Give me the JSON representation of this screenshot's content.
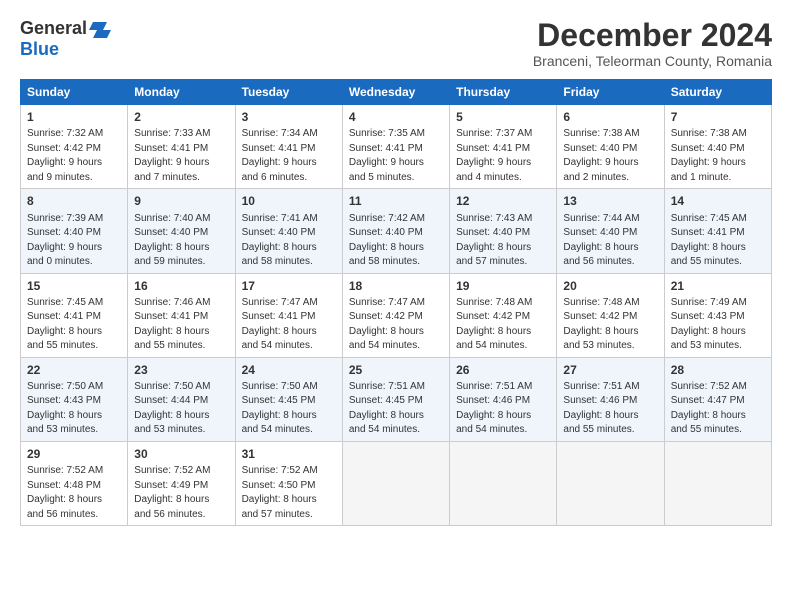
{
  "logo": {
    "general": "General",
    "blue": "Blue"
  },
  "title": {
    "month": "December 2024",
    "location": "Branceni, Teleorman County, Romania"
  },
  "weekdays": [
    "Sunday",
    "Monday",
    "Tuesday",
    "Wednesday",
    "Thursday",
    "Friday",
    "Saturday"
  ],
  "weeks": [
    [
      {
        "day": 1,
        "info": "Sunrise: 7:32 AM\nSunset: 4:42 PM\nDaylight: 9 hours\nand 9 minutes."
      },
      {
        "day": 2,
        "info": "Sunrise: 7:33 AM\nSunset: 4:41 PM\nDaylight: 9 hours\nand 7 minutes."
      },
      {
        "day": 3,
        "info": "Sunrise: 7:34 AM\nSunset: 4:41 PM\nDaylight: 9 hours\nand 6 minutes."
      },
      {
        "day": 4,
        "info": "Sunrise: 7:35 AM\nSunset: 4:41 PM\nDaylight: 9 hours\nand 5 minutes."
      },
      {
        "day": 5,
        "info": "Sunrise: 7:37 AM\nSunset: 4:41 PM\nDaylight: 9 hours\nand 4 minutes."
      },
      {
        "day": 6,
        "info": "Sunrise: 7:38 AM\nSunset: 4:40 PM\nDaylight: 9 hours\nand 2 minutes."
      },
      {
        "day": 7,
        "info": "Sunrise: 7:38 AM\nSunset: 4:40 PM\nDaylight: 9 hours\nand 1 minute."
      }
    ],
    [
      {
        "day": 8,
        "info": "Sunrise: 7:39 AM\nSunset: 4:40 PM\nDaylight: 9 hours\nand 0 minutes."
      },
      {
        "day": 9,
        "info": "Sunrise: 7:40 AM\nSunset: 4:40 PM\nDaylight: 8 hours\nand 59 minutes."
      },
      {
        "day": 10,
        "info": "Sunrise: 7:41 AM\nSunset: 4:40 PM\nDaylight: 8 hours\nand 58 minutes."
      },
      {
        "day": 11,
        "info": "Sunrise: 7:42 AM\nSunset: 4:40 PM\nDaylight: 8 hours\nand 58 minutes."
      },
      {
        "day": 12,
        "info": "Sunrise: 7:43 AM\nSunset: 4:40 PM\nDaylight: 8 hours\nand 57 minutes."
      },
      {
        "day": 13,
        "info": "Sunrise: 7:44 AM\nSunset: 4:40 PM\nDaylight: 8 hours\nand 56 minutes."
      },
      {
        "day": 14,
        "info": "Sunrise: 7:45 AM\nSunset: 4:41 PM\nDaylight: 8 hours\nand 55 minutes."
      }
    ],
    [
      {
        "day": 15,
        "info": "Sunrise: 7:45 AM\nSunset: 4:41 PM\nDaylight: 8 hours\nand 55 minutes."
      },
      {
        "day": 16,
        "info": "Sunrise: 7:46 AM\nSunset: 4:41 PM\nDaylight: 8 hours\nand 55 minutes."
      },
      {
        "day": 17,
        "info": "Sunrise: 7:47 AM\nSunset: 4:41 PM\nDaylight: 8 hours\nand 54 minutes."
      },
      {
        "day": 18,
        "info": "Sunrise: 7:47 AM\nSunset: 4:42 PM\nDaylight: 8 hours\nand 54 minutes."
      },
      {
        "day": 19,
        "info": "Sunrise: 7:48 AM\nSunset: 4:42 PM\nDaylight: 8 hours\nand 54 minutes."
      },
      {
        "day": 20,
        "info": "Sunrise: 7:48 AM\nSunset: 4:42 PM\nDaylight: 8 hours\nand 53 minutes."
      },
      {
        "day": 21,
        "info": "Sunrise: 7:49 AM\nSunset: 4:43 PM\nDaylight: 8 hours\nand 53 minutes."
      }
    ],
    [
      {
        "day": 22,
        "info": "Sunrise: 7:50 AM\nSunset: 4:43 PM\nDaylight: 8 hours\nand 53 minutes."
      },
      {
        "day": 23,
        "info": "Sunrise: 7:50 AM\nSunset: 4:44 PM\nDaylight: 8 hours\nand 53 minutes."
      },
      {
        "day": 24,
        "info": "Sunrise: 7:50 AM\nSunset: 4:45 PM\nDaylight: 8 hours\nand 54 minutes."
      },
      {
        "day": 25,
        "info": "Sunrise: 7:51 AM\nSunset: 4:45 PM\nDaylight: 8 hours\nand 54 minutes."
      },
      {
        "day": 26,
        "info": "Sunrise: 7:51 AM\nSunset: 4:46 PM\nDaylight: 8 hours\nand 54 minutes."
      },
      {
        "day": 27,
        "info": "Sunrise: 7:51 AM\nSunset: 4:46 PM\nDaylight: 8 hours\nand 55 minutes."
      },
      {
        "day": 28,
        "info": "Sunrise: 7:52 AM\nSunset: 4:47 PM\nDaylight: 8 hours\nand 55 minutes."
      }
    ],
    [
      {
        "day": 29,
        "info": "Sunrise: 7:52 AM\nSunset: 4:48 PM\nDaylight: 8 hours\nand 56 minutes."
      },
      {
        "day": 30,
        "info": "Sunrise: 7:52 AM\nSunset: 4:49 PM\nDaylight: 8 hours\nand 56 minutes."
      },
      {
        "day": 31,
        "info": "Sunrise: 7:52 AM\nSunset: 4:50 PM\nDaylight: 8 hours\nand 57 minutes."
      },
      null,
      null,
      null,
      null
    ]
  ]
}
